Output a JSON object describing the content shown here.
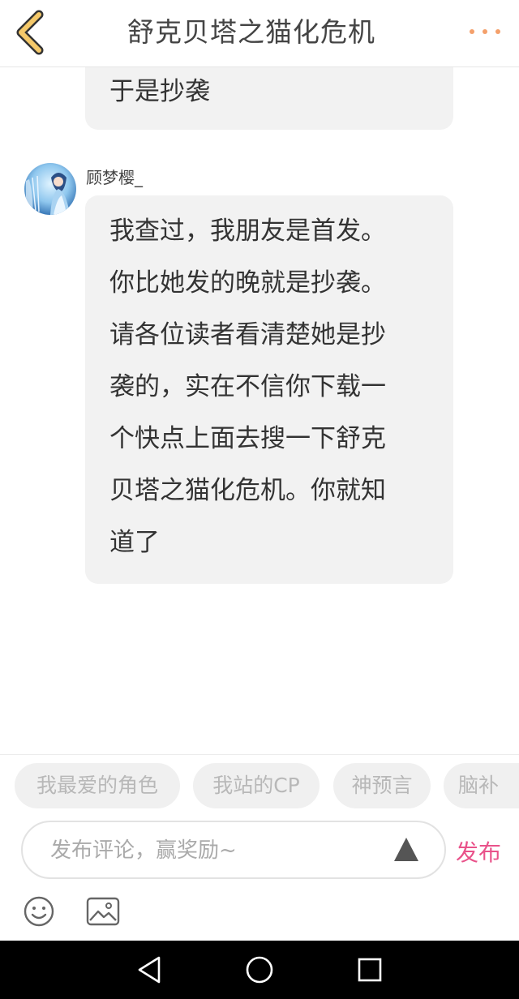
{
  "header": {
    "title": "舒克贝塔之猫化危机",
    "back_icon": "chevron-left-icon",
    "more_icon": "more-dots-icon",
    "accent_color": "#f5c96a",
    "more_color": "#f4a06b"
  },
  "messages": [
    {
      "text": "于是抄袭"
    },
    {
      "username": "顾梦樱_",
      "text": "我查过，我朋友是首发。\n你比她发的晚就是抄袭。\n请各位读者看清楚她是抄\n袭的，实在不信你下载一\n个快点上面去搜一下舒克\n贝塔之猫化危机。你就知\n道了"
    }
  ],
  "tags": [
    "我最爱的角色",
    "我站的CP",
    "神预言",
    "脑补"
  ],
  "comment": {
    "placeholder": "发布评论，赢奖励~",
    "publish_label": "发布",
    "publish_color": "#e9528a"
  },
  "toolbar": {
    "emoji_icon": "smiley-icon",
    "image_icon": "image-icon"
  },
  "navbar": {
    "back_icon": "triangle-back-icon",
    "home_icon": "circle-home-icon",
    "recent_icon": "square-recent-icon"
  }
}
